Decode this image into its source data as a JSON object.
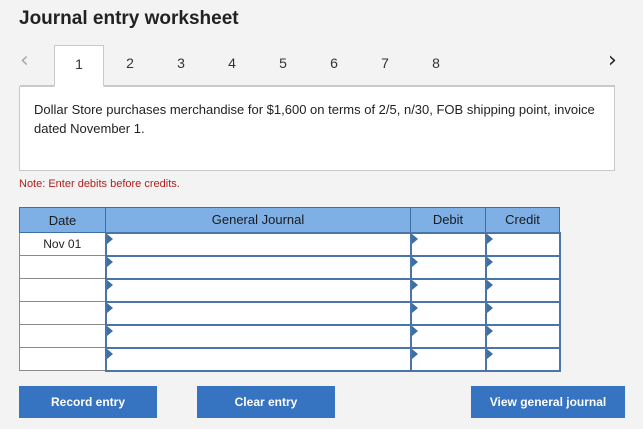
{
  "title": "Journal entry worksheet",
  "tabs": [
    "1",
    "2",
    "3",
    "4",
    "5",
    "6",
    "7",
    "8"
  ],
  "active_tab": "1",
  "icons": {
    "prev": "chevron-left-icon",
    "next": "chevron-right-icon"
  },
  "problem_text": "Dollar Store purchases merchandise for $1,600 on terms of 2/5, n/30, FOB shipping point, invoice dated November 1.",
  "note": "Note: Enter debits before credits.",
  "table": {
    "headers": {
      "date": "Date",
      "general_journal": "General Journal",
      "debit": "Debit",
      "credit": "Credit"
    },
    "rows": [
      {
        "date": "Nov 01",
        "account": "",
        "debit": "",
        "credit": ""
      },
      {
        "date": "",
        "account": "",
        "debit": "",
        "credit": ""
      },
      {
        "date": "",
        "account": "",
        "debit": "",
        "credit": ""
      },
      {
        "date": "",
        "account": "",
        "debit": "",
        "credit": ""
      },
      {
        "date": "",
        "account": "",
        "debit": "",
        "credit": ""
      },
      {
        "date": "",
        "account": "",
        "debit": "",
        "credit": ""
      }
    ]
  },
  "buttons": {
    "record": "Record entry",
    "clear": "Clear entry",
    "view": "View general journal"
  },
  "colors": {
    "header_bg": "#7eb0e6",
    "button_bg": "#3673c0",
    "note": "#b0201e"
  }
}
